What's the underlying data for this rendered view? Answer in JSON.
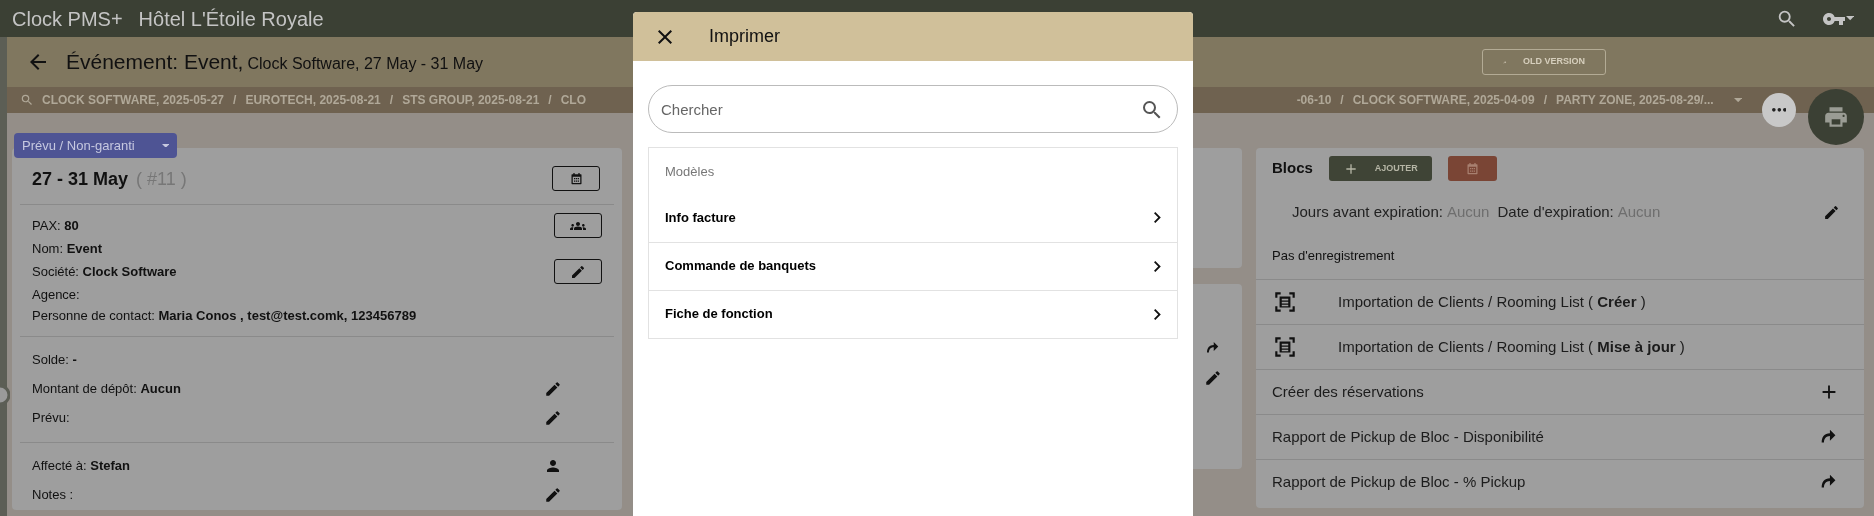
{
  "app_bar": {
    "brand": "Clock PMS+",
    "hotel": "Hôtel L'Étoile Royale"
  },
  "header": {
    "title": "Événement: Event,",
    "subtitle": "Clock Software, 27 May - 31 May",
    "old_version_button": "OLD VERSION"
  },
  "breadcrumbs": {
    "before_dialog": [
      {
        "label": "CLOCK SOFTWARE, 2025-05-27",
        "separator": "/"
      },
      {
        "label": "EUROTECH, 2025-08-21",
        "separator": "/"
      },
      {
        "label": "STS GROUP, 2025-08-21",
        "separator": "/"
      },
      {
        "label": "CLO"
      }
    ],
    "after_dialog": [
      {
        "label": "-06-10",
        "separator": "/"
      },
      {
        "label": "CLOCK SOFTWARE, 2025-04-09",
        "separator": "/"
      },
      {
        "label": "PARTY ZONE, 2025-08-29"
      },
      {
        "label": "/..."
      }
    ]
  },
  "event_card": {
    "status": "Prévu / Non-garanti",
    "dates": "27 - 31 May",
    "number": "( #11 )",
    "sections": [
      {
        "lines": [
          {
            "text": "PAX: **80**",
            "kind": "group"
          },
          {
            "text": "Nom: **Event**",
            "kind": "plain"
          },
          {
            "text": "Société: **Clock Software**",
            "kind": "edit"
          },
          {
            "text": "Agence:",
            "kind": "plain"
          },
          {
            "text": "Personne de contact: **Maria Conos , test@test.comk, 123456789**",
            "kind": "plain"
          }
        ]
      },
      {
        "lines": [
          {
            "text": "Solde: **-**",
            "kind": "plain"
          },
          {
            "text": "Montant de dépôt: **Aucun**",
            "kind": "edit"
          },
          {
            "text": "Prévu:",
            "kind": "edit"
          }
        ]
      },
      {
        "lines": [
          {
            "text": "Affecté à: **Stefan**",
            "kind": "person"
          },
          {
            "text": "Notes :",
            "kind": "edit"
          }
        ]
      }
    ]
  },
  "blocks_card": {
    "title": "Blocs",
    "add_button": "AJOUTER",
    "expiration": [
      {
        "label": "Jours avant expiration:",
        "value": "Aucun"
      },
      {
        "label": "Date d'expiration:",
        "value": "Aucun"
      }
    ],
    "empty_text": "Pas d'enregistrement",
    "rows": [
      {
        "text": "Importation de Clients / Rooming List ( **Créer** )",
        "kind": "import"
      },
      {
        "text": "Importation de Clients / Rooming List ( **Mise à jour** )",
        "kind": "import"
      },
      {
        "text": "Créer des réservations",
        "kind": "add"
      },
      {
        "text": "Rapport de Pickup de Bloc - Disponibilité",
        "kind": "open"
      },
      {
        "text": "Rapport de Pickup de Bloc - % Pickup",
        "kind": "open"
      }
    ]
  },
  "print_dialog": {
    "title": "Imprimer",
    "search": {
      "placeholder": "Chercher"
    },
    "section": "Modèles",
    "items": [
      "Info facture",
      "Commande de banquets",
      "Fiche de fonction"
    ]
  }
}
